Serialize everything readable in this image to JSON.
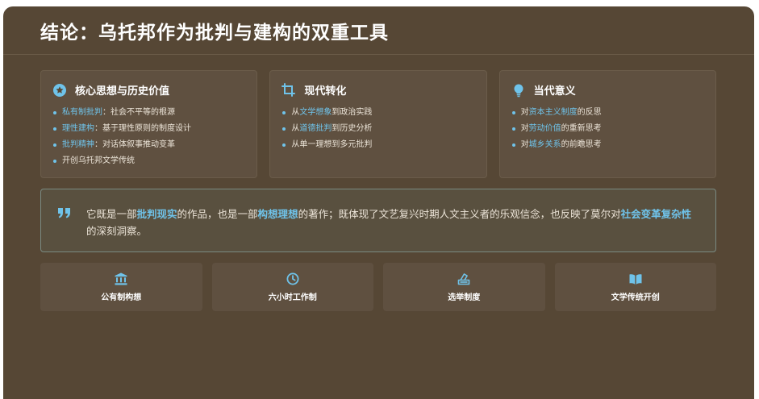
{
  "slide": {
    "title": "结论：乌托邦作为批判与建构的双重工具"
  },
  "cards": [
    {
      "icon": "star-circle-icon",
      "title": "核心思想与历史价值",
      "items": [
        {
          "hl": "私有制批判",
          "text": "：社会不平等的根源"
        },
        {
          "hl": "理性建构",
          "text": "：基于理性原则的制度设计"
        },
        {
          "hl": "批判精神",
          "text": "：对话体叙事推动变革"
        },
        {
          "pre": "开创乌托邦文学传统"
        }
      ]
    },
    {
      "icon": "crop-transform-icon",
      "title": "现代转化",
      "items": [
        {
          "pre": "从",
          "hl": "文学想象",
          "text": "到政治实践"
        },
        {
          "pre": "从",
          "hl": "道德批判",
          "text": "到历史分析"
        },
        {
          "pre": "从单一理想到多元批判"
        }
      ]
    },
    {
      "icon": "lightbulb-icon",
      "title": "当代意义",
      "items": [
        {
          "pre": "对",
          "hl": "资本主义制度",
          "text": "的反思"
        },
        {
          "pre": "对",
          "hl": "劳动价值",
          "text": "的重新思考"
        },
        {
          "pre": "对",
          "hl": "城乡关系",
          "text": "的前瞻思考"
        }
      ]
    }
  ],
  "quote": {
    "icon": "quote-icon",
    "p1": "它既是一部",
    "h1": "批判现实",
    "p2": "的作品，也是一部",
    "h2": "构想理想",
    "p3": "的著作；既体现了文艺复兴时期人文主义者的乐观信念，也反映了莫尔对",
    "h3": "社会变革复杂性",
    "p4": "的深刻洞察。"
  },
  "tiles": [
    {
      "icon": "bank-icon",
      "label": "公有制构想"
    },
    {
      "icon": "clock-icon",
      "label": "六小时工作制"
    },
    {
      "icon": "vote-box-icon",
      "label": "选举制度"
    },
    {
      "icon": "open-book-icon",
      "label": "文学传统开创"
    }
  ],
  "colors": {
    "background": "#564735",
    "card": "#5f5040",
    "accent": "#6fc3ea",
    "text": "#ece4d8"
  }
}
